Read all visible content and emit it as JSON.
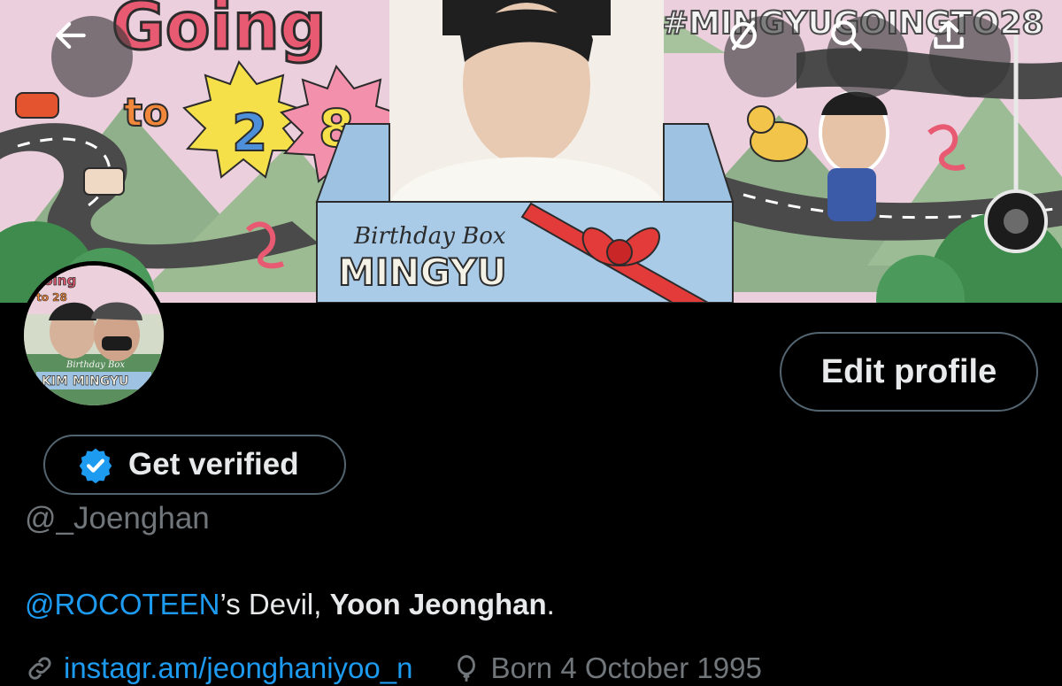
{
  "banner": {
    "headline_word": "Going",
    "to_word": "to",
    "age_digit_1": "2",
    "age_digit_2": "8",
    "hashtag": "#MINGYUGOINGTO28",
    "box_subtitle": "Birthday Box",
    "box_title": "MINGYU"
  },
  "header_actions": {
    "back_icon": "arrow-left-icon",
    "block_icon": "circle-slash-icon",
    "search_icon": "search-icon",
    "share_icon": "share-upload-icon"
  },
  "avatar": {
    "badge_line_1": "Going",
    "badge_line_2": "to 28",
    "subtitle": "Birthday Box",
    "title": "KIM MINGYU"
  },
  "profile": {
    "edit_label": "Edit profile",
    "verify_label": "Get verified",
    "handle": "@_Joenghan",
    "bio_mention": "@ROCOTEEN",
    "bio_mid": "’s Devil, ",
    "bio_bold": "Yoon Jeonghan",
    "bio_end": ".",
    "website": "instagr.am/jeonghaniyoo_n",
    "birthday": "Born 4 October 1995"
  },
  "colors": {
    "accent": "#1d9bf0",
    "muted": "#71767b",
    "border": "#536471",
    "background": "#000000"
  }
}
